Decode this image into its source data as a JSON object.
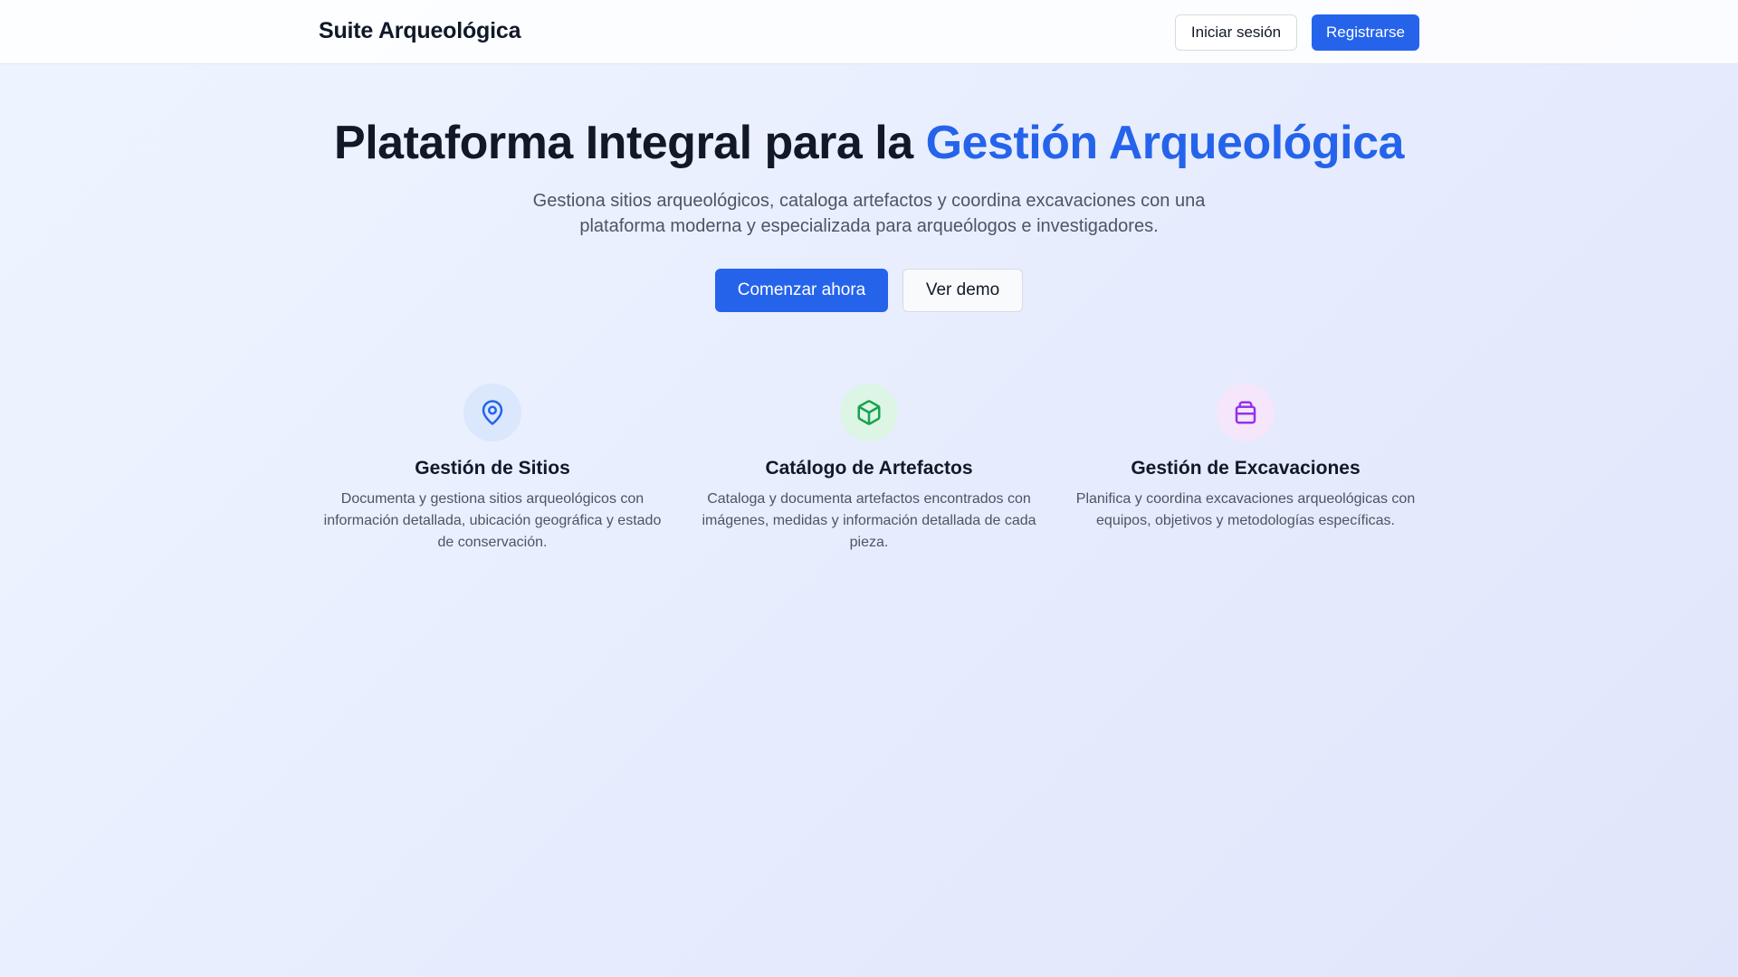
{
  "header": {
    "brand": "Suite Arqueológica",
    "login_label": "Iniciar sesión",
    "signup_label": "Registrarse"
  },
  "hero": {
    "title_main": "Plataforma Integral para la ",
    "title_accent": "Gestión Arqueológica",
    "subtitle": "Gestiona sitios arqueológicos, cataloga artefactos y coordina excavaciones con una plataforma moderna y especializada para arqueólogos e investigadores.",
    "primary_cta": "Comenzar ahora",
    "secondary_cta": "Ver demo"
  },
  "features": [
    {
      "icon": "map-pin-icon",
      "title": "Gestión de Sitios",
      "description": "Documenta y gestiona sitios arqueológicos con información detallada, ubicación geográfica y estado de conservación."
    },
    {
      "icon": "package-icon",
      "title": "Catálogo de Artefactos",
      "description": "Cataloga y documenta artefactos encontrados con imágenes, medidas y información detallada de cada pieza."
    },
    {
      "icon": "archive-icon",
      "title": "Gestión de Excavaciones",
      "description": "Planifica y coordina excavaciones arqueológicas con equipos, objetivos y metodologías específicas."
    }
  ],
  "colors": {
    "primary": "#2563eb",
    "text": "#111827",
    "muted": "#4b5563",
    "site_icon": "#2563eb",
    "artifact_icon": "#16a34a",
    "excavation_icon": "#9333ea"
  }
}
